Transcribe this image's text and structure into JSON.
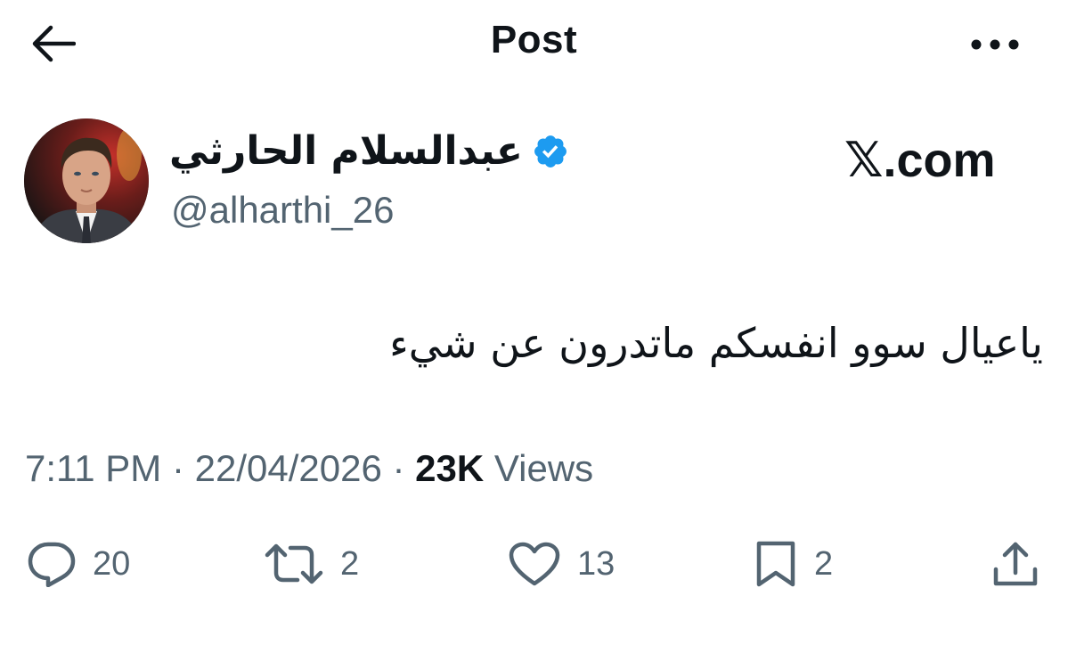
{
  "header": {
    "title": "Post",
    "back_icon": "arrow-left-icon",
    "more_icon": "more-horizontal-icon"
  },
  "author": {
    "display_name": "عبدالسلام الحارثي",
    "handle": "@alharthi_26",
    "verified": true,
    "verified_color": "#1d9bf0"
  },
  "brand": {
    "x_mark": "𝕏",
    "suffix": ".com"
  },
  "tweet": {
    "text": "ياعيال سوو انفسكم ماتدرون عن شيء"
  },
  "meta": {
    "time": "7:11 PM",
    "separator": " · ",
    "date": "22/04/2026",
    "views_count": "23K",
    "views_label": " Views"
  },
  "actions": {
    "replies": "20",
    "reposts": "2",
    "likes": "13",
    "bookmarks": "2"
  },
  "colors": {
    "text": "#0f1419",
    "secondary": "#536471",
    "accent": "#1d9bf0"
  }
}
